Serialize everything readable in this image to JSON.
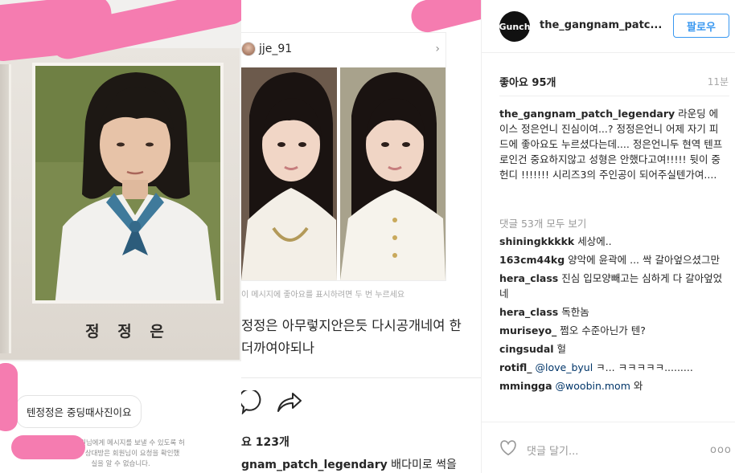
{
  "left": {
    "name_plate": "정 정 은",
    "dm_message": "텐정정은  중딩때사진이요",
    "dm_note_lines": [
      "규 이 회원님에게 메시지를 보낼 수 있도록 허",
      "2. 이상 상대방은 회원님이 요청을 확인했",
      "실을 알 수 없습니다."
    ]
  },
  "middle": {
    "username": "jje_91",
    "chevron": "›",
    "hint": "이 메시지에 좋아요를 표시하려면 두 번 누르세요",
    "caption_line1": "정정은 아무렇지안은듯 다시공개네여 한",
    "caption_line2": "더까여야되나",
    "likes": "요 123개",
    "caption2_user": "gnam_patch_legendary",
    "caption2_text": " 배다미로 썩을"
  },
  "right": {
    "avatar_text": "Gunch",
    "username": "the_gangnam_patc...",
    "follow_label": "팔로우",
    "likes": "좋아요 95개",
    "time": "11분",
    "caption_user": "the_gangnam_patch_legendary",
    "caption_text": " 라운딩 에이스 정은언니 진심이여...? 정정은언니 어제 자기 피드에 좋아요도 누르셨다는데.... 정은언니두 현역 텐프로인건 중요하지않고 성형은 안했다고여!!!!! 뒷이 중헌디 !!!!!!! 시리즈3의 주인공이 되어주실텐가여....",
    "view_all": "댓글 53개 모두 보기",
    "comments": [
      {
        "user": "shiningkkkkk",
        "text": " 세상에.."
      },
      {
        "user": "163cm44kg",
        "text": " 양악에 윤곽에 ... 싹 갈아엎으셨그만"
      },
      {
        "user": "hera_class",
        "text": " 진심 입모양빼고는 심하게 다 갈아엎었네"
      },
      {
        "user": "hera_class",
        "text": " 독한놈"
      },
      {
        "user": "muriseyo_",
        "text": " 쩜오 수준아닌가 텐?"
      },
      {
        "user": "cingsudal",
        "text": " 헐"
      },
      {
        "user": "rotifl_",
        "mention": " @love_byul",
        "text": " ㅋ... ㅋㅋㅋㅋㅋ........."
      },
      {
        "user": "mmingga",
        "mention": " @woobin.mom",
        "text": " 와"
      }
    ],
    "add_comment": "댓글 달기...",
    "more": "ooo"
  },
  "colors": {
    "redaction_pink": "#f57cb0",
    "follow_blue": "#3897f0",
    "mention_navy": "#003569"
  }
}
